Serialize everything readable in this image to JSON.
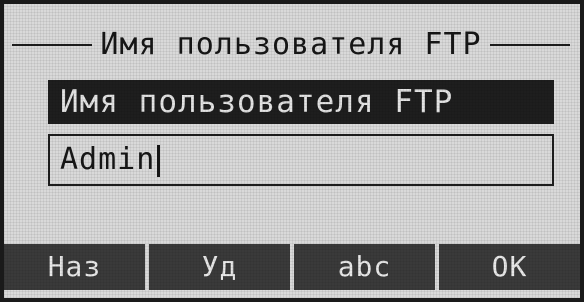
{
  "screen": {
    "title": "Имя пользователя FTP"
  },
  "field": {
    "label": "Имя пользователя FTP",
    "value": "Admin"
  },
  "softkeys": [
    {
      "label": "Наз"
    },
    {
      "label": "Уд"
    },
    {
      "label": "abc"
    },
    {
      "label": "OK"
    }
  ],
  "colors": {
    "background": "#d9d9d9",
    "foreground": "#161616",
    "highlight": "#1e1e1e",
    "softkey_bg": "#3a3a3a"
  }
}
